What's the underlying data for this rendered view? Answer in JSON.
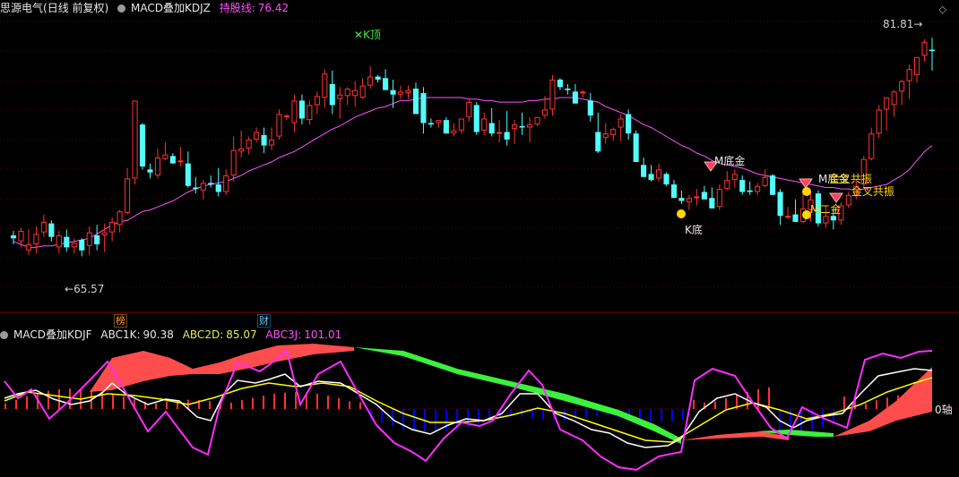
{
  "main_header": {
    "stock_name": "思源电气",
    "period_info": "(日线 前复权)",
    "indicator_name": "MACD叠加KDJZ",
    "hold_line_label": "持股线:",
    "hold_line_value": "76.42"
  },
  "sub_header": {
    "indicator_name": "MACD叠加KDJF",
    "abc1k_label": "ABC1K:",
    "abc1k_value": "90.38",
    "abc2d_label": "ABC2D:",
    "abc2d_value": "85.07",
    "abc3j_label": "ABC3J:",
    "abc3j_value": "101.01"
  },
  "price_labels": {
    "high": "81.81",
    "low": "65.57"
  },
  "annotations": {
    "k_top": "K顶",
    "k_bottom": "K底",
    "m_bottom_1": "M底金",
    "m_bottom_2": "M底金",
    "m_gold_cross": "M二金",
    "cross_resonance_1": "金叉共振",
    "cross_resonance_2": "金叉共振"
  },
  "axis_labels": {
    "zero_axis": "0轴"
  },
  "event_tags": {
    "tag_bang": "榜",
    "tag_cai": "财"
  },
  "colors": {
    "up": "#ff3232",
    "down": "#54fcfc",
    "ma": "#ff50ff",
    "macd_red": "#ff3232",
    "macd_blue": "#0000ff",
    "area_red": "#ff4c4c",
    "area_green": "#3cf03c",
    "k_line": "#ffffff",
    "d_line": "#ffff00",
    "j_line": "#ff2cff",
    "header_green": "#9bf09b",
    "hold_line": "#ff50ff"
  },
  "chart_data": {
    "type": "candlestick",
    "y_range": [
      64,
      83
    ],
    "candles": [
      [
        68.6,
        68.9,
        68.0,
        68.4
      ],
      [
        68.2,
        69.1,
        67.8,
        68.9
      ],
      [
        67.6,
        69.0,
        67.3,
        68.0
      ],
      [
        68.0,
        69.2,
        67.4,
        68.7
      ],
      [
        68.8,
        70.0,
        68.5,
        69.5
      ],
      [
        69.4,
        69.6,
        68.2,
        68.5
      ],
      [
        67.8,
        68.9,
        67.4,
        68.6
      ],
      [
        68.5,
        69.0,
        67.5,
        67.8
      ],
      [
        67.8,
        68.4,
        67.4,
        68.1
      ],
      [
        68.3,
        68.4,
        67.2,
        67.6
      ],
      [
        67.9,
        69.2,
        67.3,
        68.8
      ],
      [
        68.6,
        69.3,
        67.6,
        68.0
      ],
      [
        68.6,
        69.4,
        67.5,
        68.8
      ],
      [
        68.8,
        69.8,
        68.2,
        69.5
      ],
      [
        69.3,
        70.3,
        68.8,
        70.2
      ],
      [
        70.1,
        73.1,
        70.0,
        72.4
      ],
      [
        72.4,
        77.6,
        72.0,
        77.6
      ],
      [
        76.0,
        76.1,
        73.0,
        73.2
      ],
      [
        73.0,
        73.4,
        72.4,
        72.8
      ],
      [
        72.6,
        74.4,
        72.4,
        73.8
      ],
      [
        73.7,
        74.8,
        73.6,
        74.0
      ],
      [
        73.9,
        74.1,
        73.4,
        73.4
      ],
      [
        73.5,
        74.5,
        73.2,
        73.6
      ],
      [
        73.4,
        74.2,
        71.8,
        71.9
      ],
      [
        71.8,
        72.5,
        71.4,
        71.7
      ],
      [
        71.6,
        72.3,
        71.0,
        72.1
      ],
      [
        72.1,
        72.6,
        71.8,
        72.0
      ],
      [
        72.0,
        73.1,
        71.2,
        71.5
      ],
      [
        71.5,
        73.0,
        71.3,
        72.6
      ],
      [
        72.6,
        75.2,
        72.2,
        74.3
      ],
      [
        74.2,
        75.6,
        73.8,
        74.4
      ],
      [
        74.4,
        75.2,
        74.0,
        75.0
      ],
      [
        75.0,
        75.8,
        74.8,
        75.5
      ],
      [
        75.3,
        75.8,
        74.1,
        74.6
      ],
      [
        74.6,
        75.8,
        74.3,
        75.0
      ],
      [
        75.2,
        77.0,
        75.0,
        76.7
      ],
      [
        76.5,
        76.7,
        76.3,
        76.6
      ],
      [
        76.1,
        78.0,
        75.5,
        77.6
      ],
      [
        77.6,
        78.0,
        76.0,
        76.4
      ],
      [
        76.3,
        77.6,
        76.0,
        77.3
      ],
      [
        77.3,
        78.2,
        76.7,
        77.9
      ],
      [
        77.8,
        79.7,
        77.1,
        79.4
      ],
      [
        78.7,
        79.6,
        76.7,
        77.3
      ],
      [
        77.7,
        78.5,
        76.4,
        78.0
      ],
      [
        77.9,
        78.5,
        77.3,
        78.4
      ],
      [
        77.9,
        78.9,
        77.2,
        78.3
      ],
      [
        77.8,
        79.1,
        77.7,
        78.6
      ],
      [
        78.6,
        79.9,
        78.4,
        79.2
      ],
      [
        79.2,
        79.3,
        78.8,
        79.0
      ],
      [
        79.1,
        79.7,
        78.4,
        78.3
      ],
      [
        78.3,
        79.0,
        77.1,
        78.0
      ],
      [
        78.0,
        78.6,
        77.7,
        78.2
      ],
      [
        78.1,
        78.6,
        77.7,
        78.3
      ],
      [
        78.4,
        78.8,
        76.7,
        76.7
      ],
      [
        78.1,
        78.5,
        75.4,
        76.1
      ],
      [
        76.1,
        76.4,
        75.8,
        76.0
      ],
      [
        76.1,
        76.3,
        75.8,
        76.3
      ],
      [
        76.3,
        76.5,
        75.4,
        75.4
      ],
      [
        75.4,
        76.1,
        75.2,
        75.6
      ],
      [
        75.6,
        76.4,
        75.4,
        76.4
      ],
      [
        76.5,
        77.7,
        76.2,
        77.5
      ],
      [
        77.3,
        77.5,
        75.3,
        75.5
      ],
      [
        75.6,
        76.8,
        75.3,
        76.4
      ],
      [
        76.1,
        77.1,
        75.2,
        75.4
      ],
      [
        75.4,
        76.3,
        74.8,
        75.5
      ],
      [
        75.5,
        76.9,
        74.6,
        75.0
      ],
      [
        75.7,
        76.3,
        74.7,
        76.0
      ],
      [
        75.9,
        76.8,
        75.3,
        75.8
      ],
      [
        75.8,
        76.5,
        74.8,
        76.0
      ],
      [
        76.0,
        76.5,
        75.9,
        76.5
      ],
      [
        76.6,
        77.9,
        76.4,
        77.0
      ],
      [
        77.0,
        79.3,
        76.6,
        79.0
      ],
      [
        79.0,
        79.1,
        78.3,
        78.5
      ],
      [
        78.4,
        78.7,
        78.0,
        78.3
      ],
      [
        78.2,
        78.7,
        77.6,
        77.4
      ],
      [
        78.1,
        78.3,
        77.8,
        78.2
      ],
      [
        77.6,
        78.1,
        76.2,
        76.6
      ],
      [
        75.5,
        76.8,
        74.1,
        74.2
      ],
      [
        75.1,
        76.1,
        74.7,
        75.4
      ],
      [
        75.3,
        75.8,
        74.9,
        75.7
      ],
      [
        75.8,
        76.7,
        74.9,
        76.4
      ],
      [
        76.7,
        77.0,
        75.0,
        75.4
      ],
      [
        75.4,
        75.6,
        73.5,
        73.5
      ],
      [
        73.3,
        73.8,
        72.5,
        72.5
      ],
      [
        72.7,
        73.3,
        72.2,
        72.3
      ],
      [
        72.4,
        73.4,
        72.2,
        73.0
      ],
      [
        72.7,
        72.8,
        71.9,
        72.0
      ],
      [
        72.0,
        72.3,
        71.1,
        71.1
      ],
      [
        71.1,
        71.6,
        70.7,
        70.9
      ],
      [
        70.8,
        71.3,
        70.3,
        71.1
      ],
      [
        71.1,
        71.7,
        70.6,
        71.2
      ],
      [
        71.5,
        71.9,
        71.0,
        71.0
      ],
      [
        71.1,
        71.8,
        70.4,
        70.4
      ],
      [
        70.5,
        72.0,
        70.3,
        71.7
      ],
      [
        71.7,
        72.9,
        71.6,
        72.3
      ],
      [
        72.3,
        73.0,
        71.8,
        72.7
      ],
      [
        72.3,
        72.6,
        71.3,
        71.5
      ],
      [
        71.6,
        72.2,
        71.3,
        71.5
      ],
      [
        71.5,
        72.1,
        71.3,
        71.9
      ],
      [
        71.9,
        73.0,
        71.8,
        72.5
      ],
      [
        72.6,
        72.7,
        71.9,
        71.3
      ],
      [
        71.5,
        71.7,
        69.3,
        69.9
      ],
      [
        69.9,
        70.5,
        69.7,
        69.9
      ],
      [
        70.0,
        71.0,
        69.7,
        69.5
      ],
      [
        69.5,
        71.5,
        69.4,
        70.4
      ],
      [
        70.3,
        71.5,
        69.5,
        71.0
      ],
      [
        71.4,
        71.6,
        69.2,
        69.4
      ],
      [
        69.4,
        70.6,
        69.1,
        69.9
      ],
      [
        69.9,
        70.4,
        69.0,
        69.6
      ],
      [
        69.6,
        70.8,
        69.3,
        70.6
      ],
      [
        70.6,
        71.5,
        70.4,
        71.3
      ],
      [
        71.3,
        72.3,
        71.0,
        71.9
      ],
      [
        72.0,
        73.9,
        71.8,
        73.7
      ],
      [
        73.7,
        75.8,
        73.6,
        75.4
      ],
      [
        75.4,
        77.3,
        75.1,
        77.0
      ],
      [
        77.0,
        77.6,
        75.6,
        77.8
      ],
      [
        77.3,
        78.3,
        76.5,
        78.2
      ],
      [
        78.2,
        79.0,
        77.3,
        78.9
      ],
      [
        78.9,
        80.0,
        77.7,
        79.7
      ],
      [
        79.3,
        80.3,
        78.8,
        80.5
      ],
      [
        80.6,
        81.7,
        80.2,
        81.5
      ],
      [
        81.0,
        81.8,
        79.6,
        80.9
      ]
    ],
    "hold_line": [
      68.2,
      68.0,
      67.8,
      67.8,
      67.9,
      67.9,
      68.0,
      68.1,
      68.2,
      68.3,
      68.4,
      68.7,
      69.0,
      69.3,
      69.5,
      69.6,
      69.9,
      70.2,
      70.3,
      70.5,
      70.7,
      70.9,
      71.2,
      71.5,
      71.7,
      71.9,
      72.0,
      72.1,
      72.2,
      72.4,
      72.6,
      72.9,
      73.1,
      73.3,
      73.5,
      73.8,
      74.0,
      74.2,
      74.5,
      74.8,
      75.1,
      75.4,
      75.7,
      75.9,
      76.2,
      76.5,
      76.7,
      76.9,
      77.1,
      77.2,
      77.4,
      77.6,
      77.6,
      77.7,
      77.8,
      77.8,
      77.8,
      77.8,
      77.8,
      77.8,
      77.7,
      77.7,
      77.6,
      77.6,
      77.5,
      77.5,
      77.5,
      77.5,
      77.6,
      77.6,
      77.7,
      77.7,
      77.8,
      77.8,
      77.8,
      77.7,
      77.6,
      77.5,
      77.2,
      77.0,
      76.8,
      76.6,
      76.3,
      76.0,
      75.8,
      75.5,
      75.2,
      74.9,
      74.6,
      74.4,
      74.1,
      73.9,
      73.6,
      73.4,
      73.3,
      73.2,
      73.1,
      72.9,
      72.7,
      72.6,
      72.5,
      72.4,
      72.3,
      72.2,
      72.1,
      72.0,
      71.9,
      71.8,
      71.8,
      71.7,
      71.7,
      71.6,
      71.7,
      71.8,
      71.9,
      72.0,
      72.3,
      72.6,
      73.0,
      73.6,
      74.2,
      74.6
    ]
  }
}
